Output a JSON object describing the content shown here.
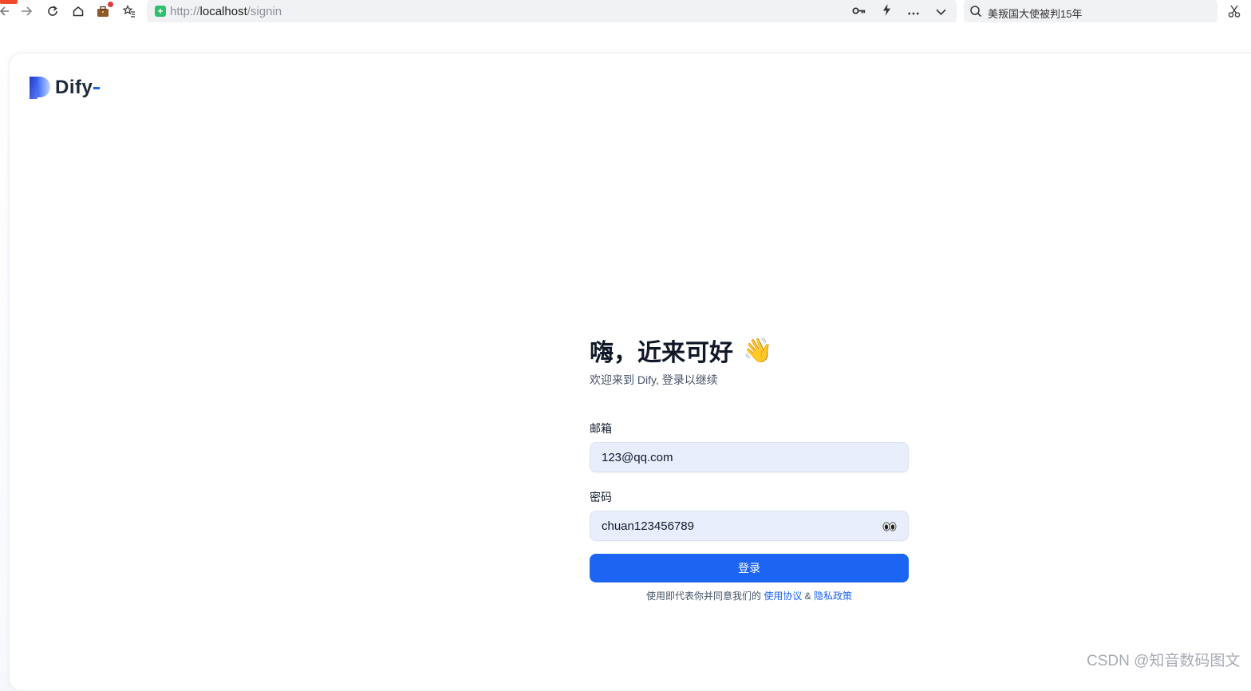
{
  "browser": {
    "url_scheme": "http://",
    "url_host": "localhost",
    "url_path": "/signin",
    "search_text": "美叛国大使被判15年"
  },
  "app": {
    "logo_text": "Dify"
  },
  "signin": {
    "title": "嗨，近来可好",
    "wave_emoji": "👋",
    "subtitle": "欢迎来到 Dify, 登录以继续",
    "email_label": "邮箱",
    "email_value": "123@qq.com",
    "password_label": "密码",
    "password_value": "chuan123456789",
    "submit_label": "登录",
    "terms_prefix": "使用即代表你并同意我们的",
    "terms_link": "使用协议",
    "terms_and": "&",
    "privacy_link": "隐私政策"
  },
  "watermark": "CSDN @知音数码图文",
  "colors": {
    "accent": "#1c64f2",
    "input_bg": "#e8eefb"
  }
}
